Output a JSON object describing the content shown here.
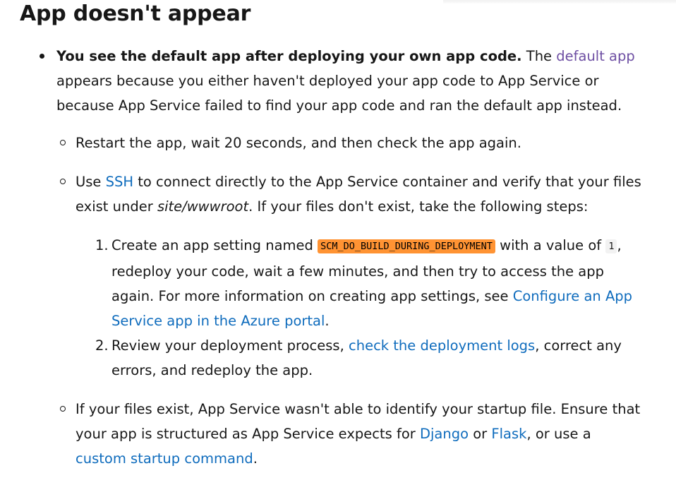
{
  "section": {
    "title": "App doesn't appear"
  },
  "bullet": {
    "heading": "You see the default app after deploying your own app code.",
    "text_1": " The ",
    "link_default_app": "default app",
    "text_2": " appears because you either haven't deployed your app code to App Service or because App Service failed to find your app code and ran the default app instead."
  },
  "sub1": {
    "text": "Restart the app, wait 20 seconds, and then check the app again."
  },
  "sub2": {
    "text_1": "Use ",
    "link_ssh": "SSH",
    "text_2": " to connect directly to the App Service container and verify that your files exist under ",
    "path": "site/wwwroot",
    "text_3": ". If your files don't exist, take the following steps:"
  },
  "steps": [
    {
      "number": "1.",
      "text_1": "Create an app setting named ",
      "code_setting": "SCM_DO_BUILD_DURING_DEPLOYMENT",
      "text_2": " with a value of ",
      "code_value": "1",
      "text_3": ", redeploy your code, wait a few minutes, and then try to access the app again. For more information on creating app settings, see ",
      "link": "Configure an App Service app in the Azure portal",
      "text_4": "."
    },
    {
      "number": "2.",
      "text_1": "Review your deployment process, ",
      "link": "check the deployment logs",
      "text_2": ", correct any errors, and redeploy the app."
    }
  ],
  "sub3": {
    "text_1": "If your files exist, App Service wasn't able to identify your startup file. Ensure that your app is structured as App Service expects for ",
    "link_django": "Django",
    "text_2": " or ",
    "link_flask": "Flask",
    "text_3": ", or use a ",
    "link_custom": "custom startup command",
    "text_4": "."
  },
  "colors": {
    "link": "#0f6cbd",
    "visited_link": "#6e4fa3",
    "highlight": "#ff9333",
    "text": "#171717"
  }
}
